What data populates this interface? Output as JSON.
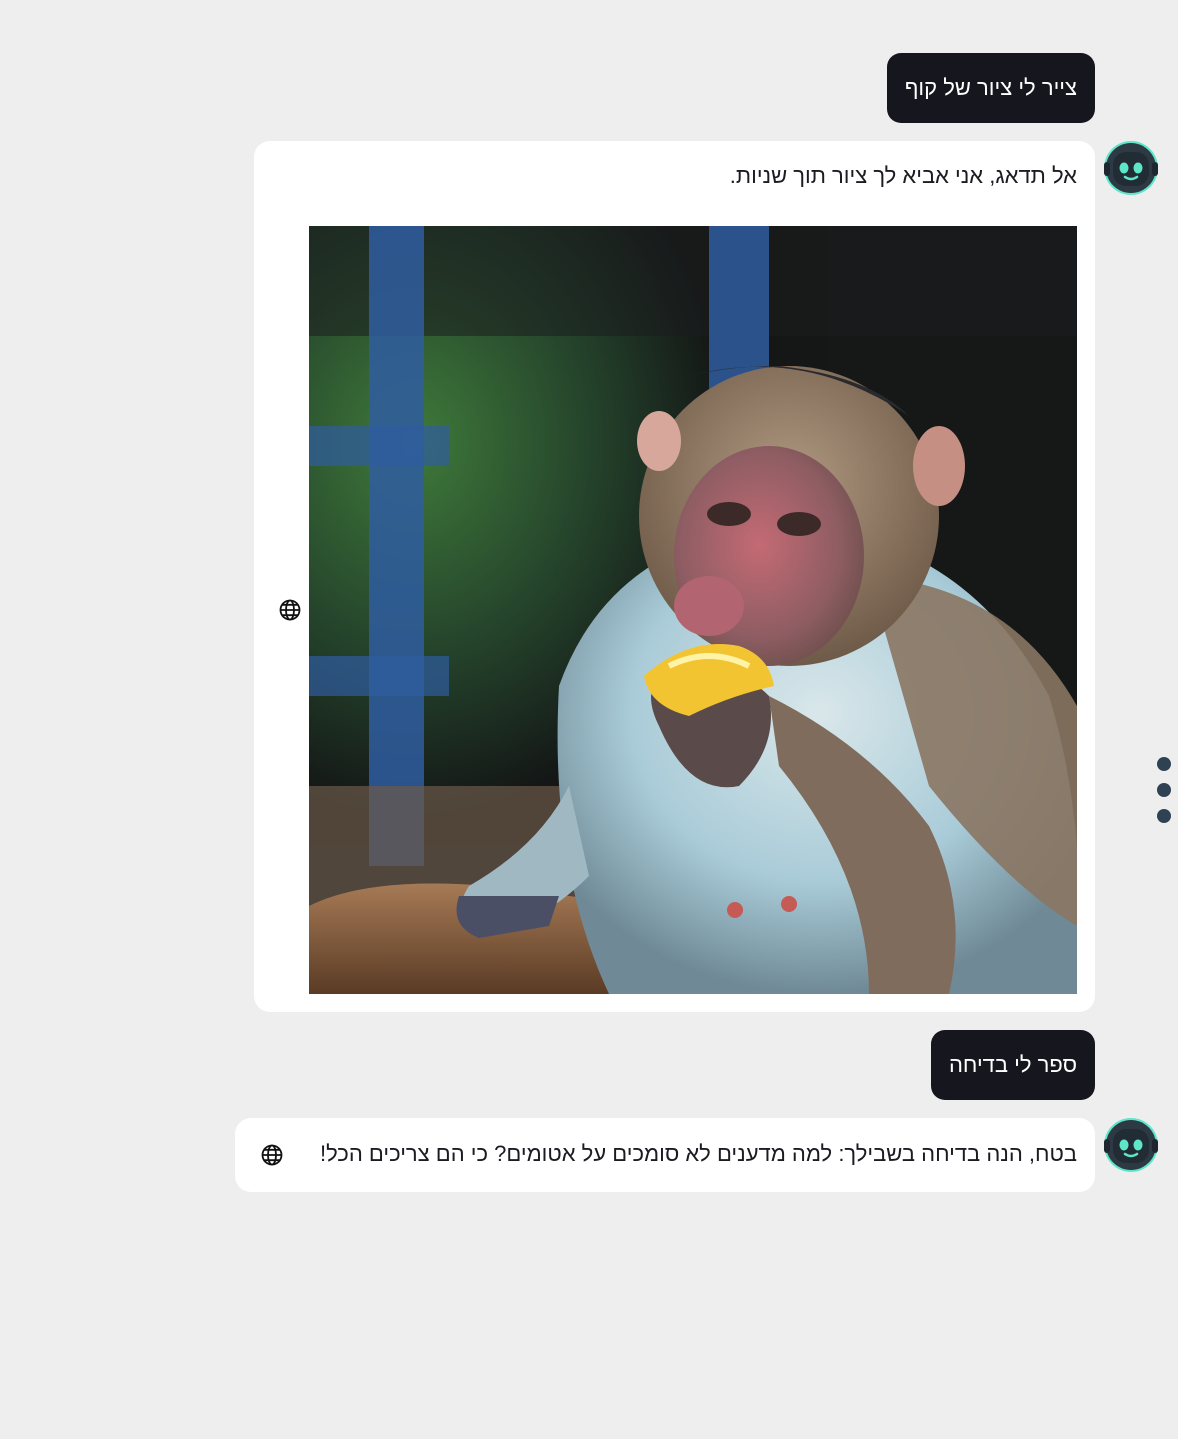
{
  "messages": [
    {
      "role": "user",
      "text": "צייר לי ציור של קוף"
    },
    {
      "role": "assistant",
      "text": "אל תדאג, אני אביא לך ציור תוך שניות.",
      "has_image": true,
      "image_subject": "monkey-eating-fruit"
    },
    {
      "role": "user",
      "text": "ספר לי בדיחה"
    },
    {
      "role": "assistant",
      "text": "בטח, הנה בדיחה בשבילך: למה מדענים לא סומכים על אטומים? כי הם צריכים הכל!"
    }
  ],
  "icons": {
    "avatar": "robot-icon",
    "translate": "globe-icon",
    "menu": "more-vertical-icon"
  },
  "colors": {
    "page_background": "#eeeeee",
    "user_bubble": "#16161e",
    "assistant_bubble": "#ffffff",
    "avatar_accent": "#5ee6c8",
    "menu_dots": "#2f4254"
  }
}
